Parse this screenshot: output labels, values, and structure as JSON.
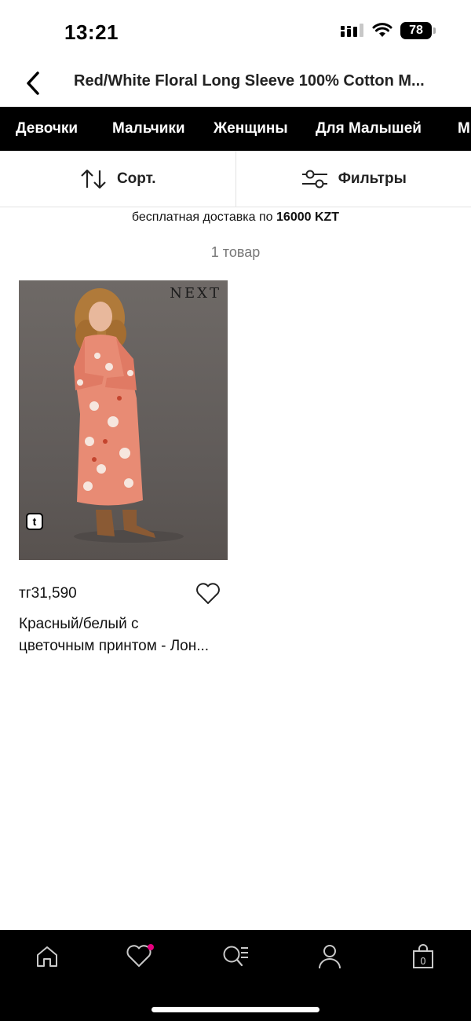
{
  "status": {
    "time": "13:21",
    "battery": "78"
  },
  "header": {
    "title": "Red/White Floral Long Sleeve 100% Cotton M..."
  },
  "categories": [
    "Девочки",
    "Мальчики",
    "Женщины",
    "Для Малышей",
    "М"
  ],
  "toolbar": {
    "sort_label": "Сорт.",
    "filter_label": "Фильтры"
  },
  "delivery": {
    "text": "бесплатная доставка по ",
    "amount": "16000 KZT"
  },
  "results": {
    "count": "1 товар"
  },
  "products": [
    {
      "brand": "NEXT",
      "badge": "t",
      "price": "тг31,590",
      "name_line1": "Красный/белый с",
      "name_line2": "цветочным принтом - Лон..."
    }
  ],
  "tabbar": {
    "items": [
      "home-icon",
      "wishlist-icon",
      "search-icon",
      "account-icon",
      "bag-icon"
    ],
    "bag_count": "0",
    "wishlist_dot_color": "#e6007e"
  }
}
